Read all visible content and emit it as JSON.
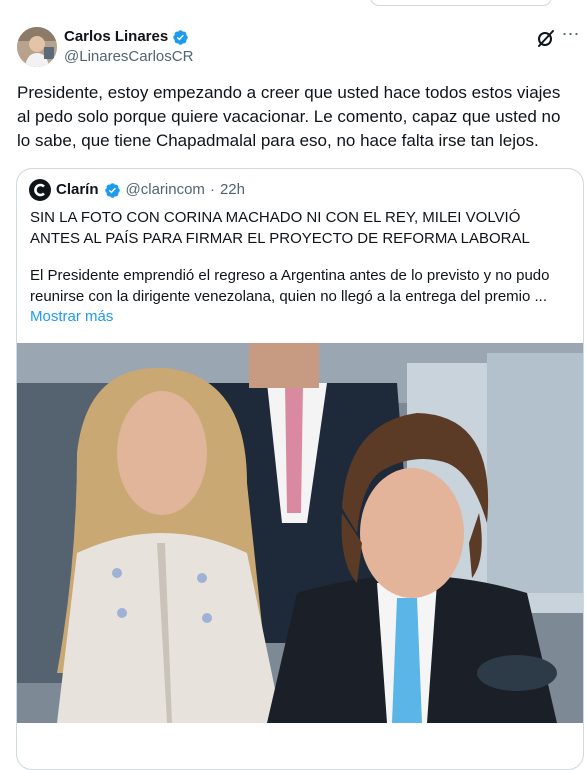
{
  "tweet": {
    "author_name": "Carlos Linares",
    "author_handle": "@LinaresCarlosCR",
    "text": "Presidente, estoy empezando a creer que usted hace todos estos viajes al pedo solo porque quiere vacacionar. Le comento, capaz que usted no lo sabe, que tiene Chapadmalal para eso, no hace falta irse tan lejos.",
    "more_icon": "⋯"
  },
  "quote": {
    "name": "Clarín",
    "handle": "@clarincom",
    "separator": "·",
    "time": "22h",
    "headline": "SIN LA FOTO CON CORINA MACHADO NI CON EL REY, MILEI VOLVIÓ ANTES AL PAÍS PARA FIRMAR EL PROYECTO DE REFORMA LABORAL",
    "summary": "El Presidente emprendió el regreso a Argentina antes de lo previsto y no pudo reunirse con la dirigente venezolana, quien no llegó a la entrega del premio ...",
    "show_more": "Mostrar más"
  },
  "colors": {
    "verified": "#1d9bf0",
    "link": "#1d9bf0",
    "secondary_text": "#536471",
    "border": "#cfd9de"
  },
  "icons": {
    "verified": "verified-badge-icon",
    "grok": "grok-icon",
    "more": "more-icon",
    "publisher_logo": "clarin-logo"
  }
}
